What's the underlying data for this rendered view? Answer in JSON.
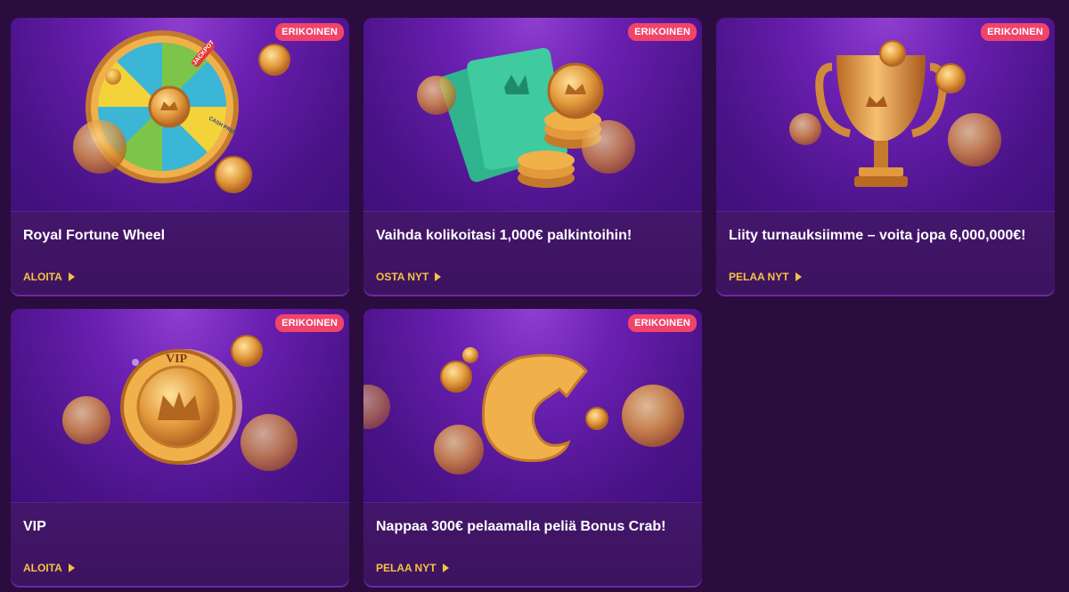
{
  "cards": [
    {
      "badge": "ERIKOINEN",
      "title": "Royal Fortune Wheel",
      "cta": "ALOITA",
      "image": "fortune-wheel-illustration"
    },
    {
      "badge": "ERIKOINEN",
      "title": "Vaihda kolikoitasi 1,000€ palkintoihin!",
      "cta": "OSTA NYT",
      "image": "tickets-and-coins-illustration"
    },
    {
      "badge": "ERIKOINEN",
      "title": "Liity turnauksiimme – voita jopa 6,000,000€!",
      "cta": "PELAA NYT",
      "image": "trophy-illustration"
    },
    {
      "badge": "ERIKOINEN",
      "title": "VIP",
      "cta": "ALOITA",
      "image": "vip-coin-illustration"
    },
    {
      "badge": "ERIKOINEN",
      "title": "Nappaa 300€ pelaamalla peliä Bonus Crab!",
      "cta": "PELAA NYT",
      "image": "crab-claw-illustration"
    }
  ],
  "wheel_labels": {
    "jackpot": "JACKPOT",
    "cash_prize": "CASH PRIZE"
  },
  "vip_text": "VIP",
  "colors": {
    "background": "#2a0d3e",
    "card": "#3f1466",
    "badge": "#f0446a",
    "cta": "#f5c242"
  }
}
